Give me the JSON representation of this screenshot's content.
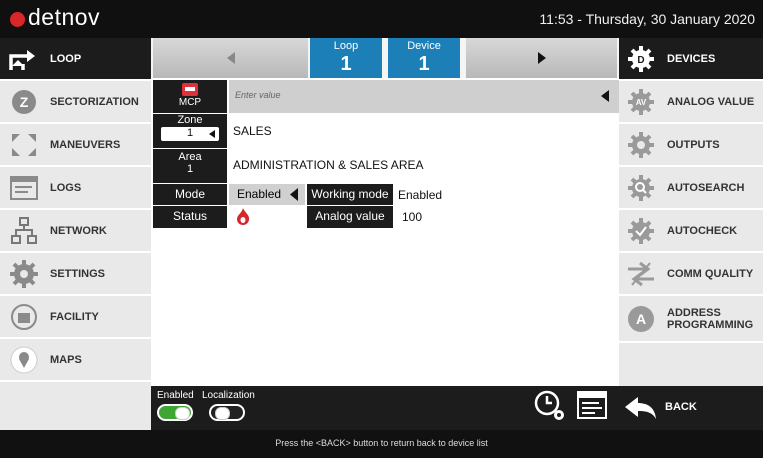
{
  "app": {
    "brand": "detnov",
    "clock": "11:53  -  Thursday, 30 January 2020"
  },
  "left_nav": [
    {
      "label": "LOOP",
      "icon": "loop-arrows-icon"
    },
    {
      "label": "SECTORIZATION",
      "icon": "zone-z-icon"
    },
    {
      "label": "MANEUVERS",
      "icon": "maneuvers-icon"
    },
    {
      "label": "LOGS",
      "icon": "logs-icon"
    },
    {
      "label": "NETWORK",
      "icon": "network-icon"
    },
    {
      "label": "SETTINGS",
      "icon": "gear-icon"
    },
    {
      "label": "FACILITY",
      "icon": "facility-icon"
    },
    {
      "label": "MAPS",
      "icon": "map-pin-icon"
    }
  ],
  "right_nav": [
    {
      "label": "DEVICES",
      "icon": "devices-icon"
    },
    {
      "label": "ANALOG VALUE",
      "icon": "analog-value-icon"
    },
    {
      "label": "OUTPUTS",
      "icon": "outputs-icon"
    },
    {
      "label": "AUTOSEARCH",
      "icon": "autosearch-icon"
    },
    {
      "label": "AUTOCHECK",
      "icon": "autocheck-icon"
    },
    {
      "label": "COMM QUALITY",
      "icon": "comm-quality-icon"
    },
    {
      "label": "ADDRESS",
      "label2": "PROGRAMMING",
      "icon": "address-programming-icon"
    }
  ],
  "header": {
    "loop_label": "Loop",
    "loop_value": "1",
    "device_label": "Device",
    "device_value": "1"
  },
  "device": {
    "type": "MCP",
    "input_placeholder": "Enter value",
    "zone_label": "Zone",
    "zone_value": "1",
    "zone_name": "SALES",
    "area_label": "Area",
    "area_value": "1",
    "area_name": "ADMINISTRATION & SALES AREA",
    "mode_label": "Mode",
    "mode_value": "Enabled",
    "working_mode_label": "Working mode",
    "working_mode_value": "Enabled",
    "status_label": "Status",
    "analog_label": "Analog value",
    "analog_value": "100"
  },
  "footer": {
    "enabled_label": "Enabled",
    "localization_label": "Localization",
    "enabled_on": true,
    "localization_on": false,
    "back_label": "BACK",
    "status_text": "Press the <BACK> button to return back to device list"
  },
  "colors": {
    "accent": "#1d7fb8",
    "alarm": "#d8262b",
    "toggle_on": "#3fa535"
  }
}
